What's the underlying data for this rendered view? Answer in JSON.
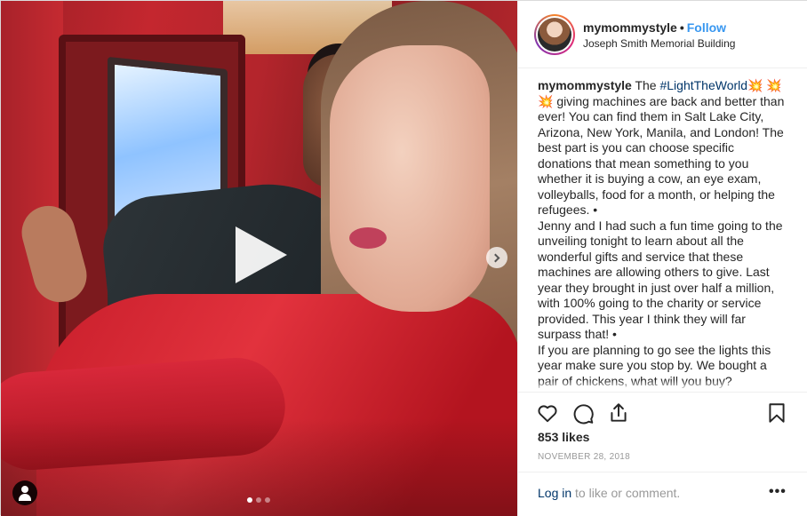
{
  "post": {
    "username": "mymommystyle",
    "separator": "•",
    "follow_label": "Follow",
    "location": "Joseph Smith Memorial Building",
    "caption": {
      "username": "mymommystyle",
      "text_before_tag": " The ",
      "hashtag": "#LightTheWorld",
      "text_after": "💥 💥 💥 giving machines are back and better than ever! You can find them in Salt Lake City, Arizona, New York, Manila, and London! The best part is you can choose specific donations that mean something to you whether it is buying a cow, an eye exam, volleyballs, food for a month, or helping the refugees. •",
      "paragraph2": "Jenny and I had such a fun time going to the unveiling tonight to learn about all the wonderful gifts and service that these machines are allowing others to give. Last year they brought in just over half a million, with 100% going to the charity or service provided. This year I think they will far surpass that! •",
      "paragraph3": "If you are planning to go see the lights this year make sure you stop by. We bought a pair of chickens, what will you buy?"
    },
    "likes": "853 likes",
    "date": "NOVEMBER 28, 2018",
    "login_link": "Log in",
    "login_text": " to like or comment.",
    "more_label": "•••",
    "media": {
      "carousel_index": 1,
      "carousel_count": 3,
      "is_video": true
    }
  },
  "icons": {
    "like": "heart-icon",
    "comment": "comment-icon",
    "share": "share-icon",
    "save": "bookmark-icon",
    "play": "play-icon",
    "next": "chevron-right-icon",
    "user_tag": "user-icon"
  },
  "colors": {
    "link": "#3897f0",
    "text": "#262626",
    "muted": "#999999",
    "hashtag": "#003569"
  }
}
